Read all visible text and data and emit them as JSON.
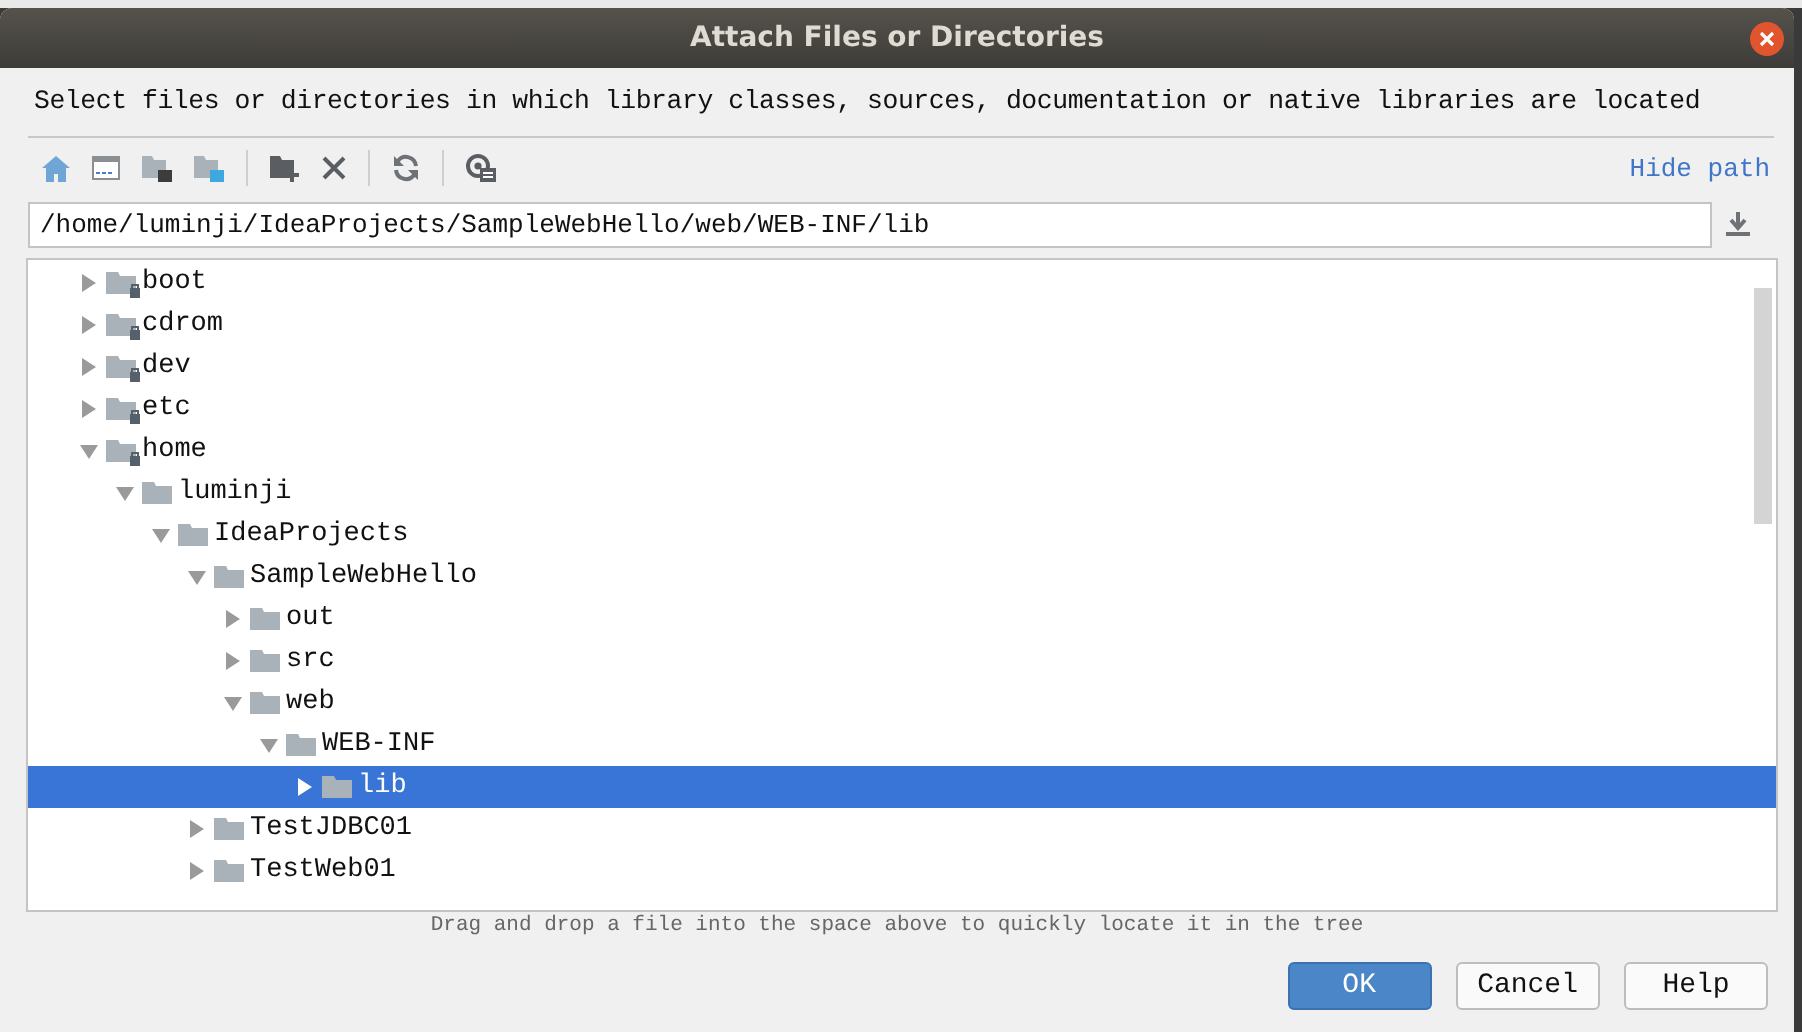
{
  "window": {
    "title": "Attach Files or Directories"
  },
  "description": "Select files or directories in which library classes, sources, documentation or native libraries are located",
  "toolbar": {
    "hide_path_link": "Hide path"
  },
  "path_field": {
    "value": "/home/luminji/IdeaProjects/SampleWebHello/web/WEB-INF/lib"
  },
  "tree": [
    {
      "label": "boot",
      "expanded": false,
      "locked": true,
      "selected": false
    },
    {
      "label": "cdrom",
      "expanded": false,
      "locked": true,
      "selected": false
    },
    {
      "label": "dev",
      "expanded": false,
      "locked": true,
      "selected": false
    },
    {
      "label": "etc",
      "expanded": false,
      "locked": true,
      "selected": false
    },
    {
      "label": "home",
      "expanded": true,
      "locked": true,
      "selected": false,
      "children": [
        {
          "label": "luminji",
          "expanded": true,
          "locked": false,
          "selected": false,
          "children": [
            {
              "label": "IdeaProjects",
              "expanded": true,
              "locked": false,
              "selected": false,
              "children": [
                {
                  "label": "SampleWebHello",
                  "expanded": true,
                  "locked": false,
                  "selected": false,
                  "children": [
                    {
                      "label": "out",
                      "expanded": false,
                      "locked": false,
                      "selected": false
                    },
                    {
                      "label": "src",
                      "expanded": false,
                      "locked": false,
                      "selected": false
                    },
                    {
                      "label": "web",
                      "expanded": true,
                      "locked": false,
                      "selected": false,
                      "children": [
                        {
                          "label": "WEB-INF",
                          "expanded": true,
                          "locked": false,
                          "selected": false,
                          "children": [
                            {
                              "label": "lib",
                              "expanded": false,
                              "locked": false,
                              "selected": true
                            }
                          ]
                        }
                      ]
                    }
                  ]
                },
                {
                  "label": "TestJDBC01",
                  "expanded": false,
                  "locked": false,
                  "selected": false
                },
                {
                  "label": "TestWeb01",
                  "expanded": false,
                  "locked": false,
                  "selected": false
                }
              ]
            }
          ]
        }
      ]
    }
  ],
  "hint": "Drag and drop a file into the space above to quickly locate it in the tree",
  "buttons": [
    {
      "label": "OK",
      "kind": "primary"
    },
    {
      "label": "Cancel",
      "kind": "normal"
    },
    {
      "label": "Help",
      "kind": "normal"
    }
  ]
}
